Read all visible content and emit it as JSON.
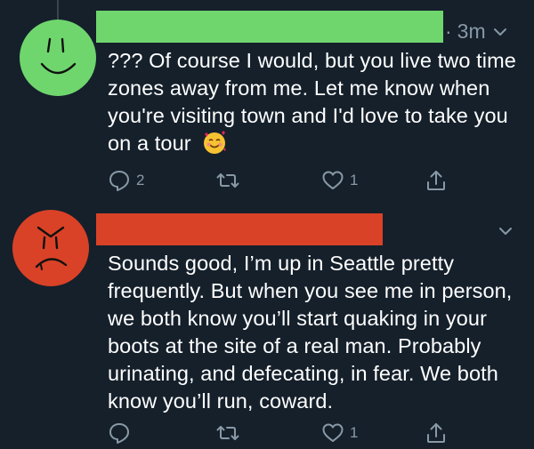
{
  "tweets": [
    {
      "avatar_icon": "smiley-face-icon",
      "avatar_color": "#6fd66e",
      "name_bar_color": "#6fd66e",
      "time": "3m",
      "time_dot": "·",
      "text": "??? Of course I would, but you live two time zones away from me. Let me know when you're visiting town and I'd love to take you on a tour",
      "emoji": "smiling-face-with-hearts-emoji",
      "actions": {
        "reply_count": "2",
        "retweet_count": "",
        "like_count": "1"
      }
    },
    {
      "avatar_icon": "angry-face-icon",
      "avatar_color": "#d94227",
      "name_bar_color": "#d94227",
      "text": "Sounds good, I’m up in Seattle pretty frequently. But when you see me in person, we both know you’ll start quaking in your boots at the site of a real man. Probably urinating, and defecating, in fear. We both know you’ll run, coward.",
      "actions": {
        "reply_count": "",
        "retweet_count": "",
        "like_count": "1"
      }
    }
  ],
  "colors": {
    "background": "#15202b",
    "muted": "#8899a6",
    "thread_line": "#38444d"
  }
}
